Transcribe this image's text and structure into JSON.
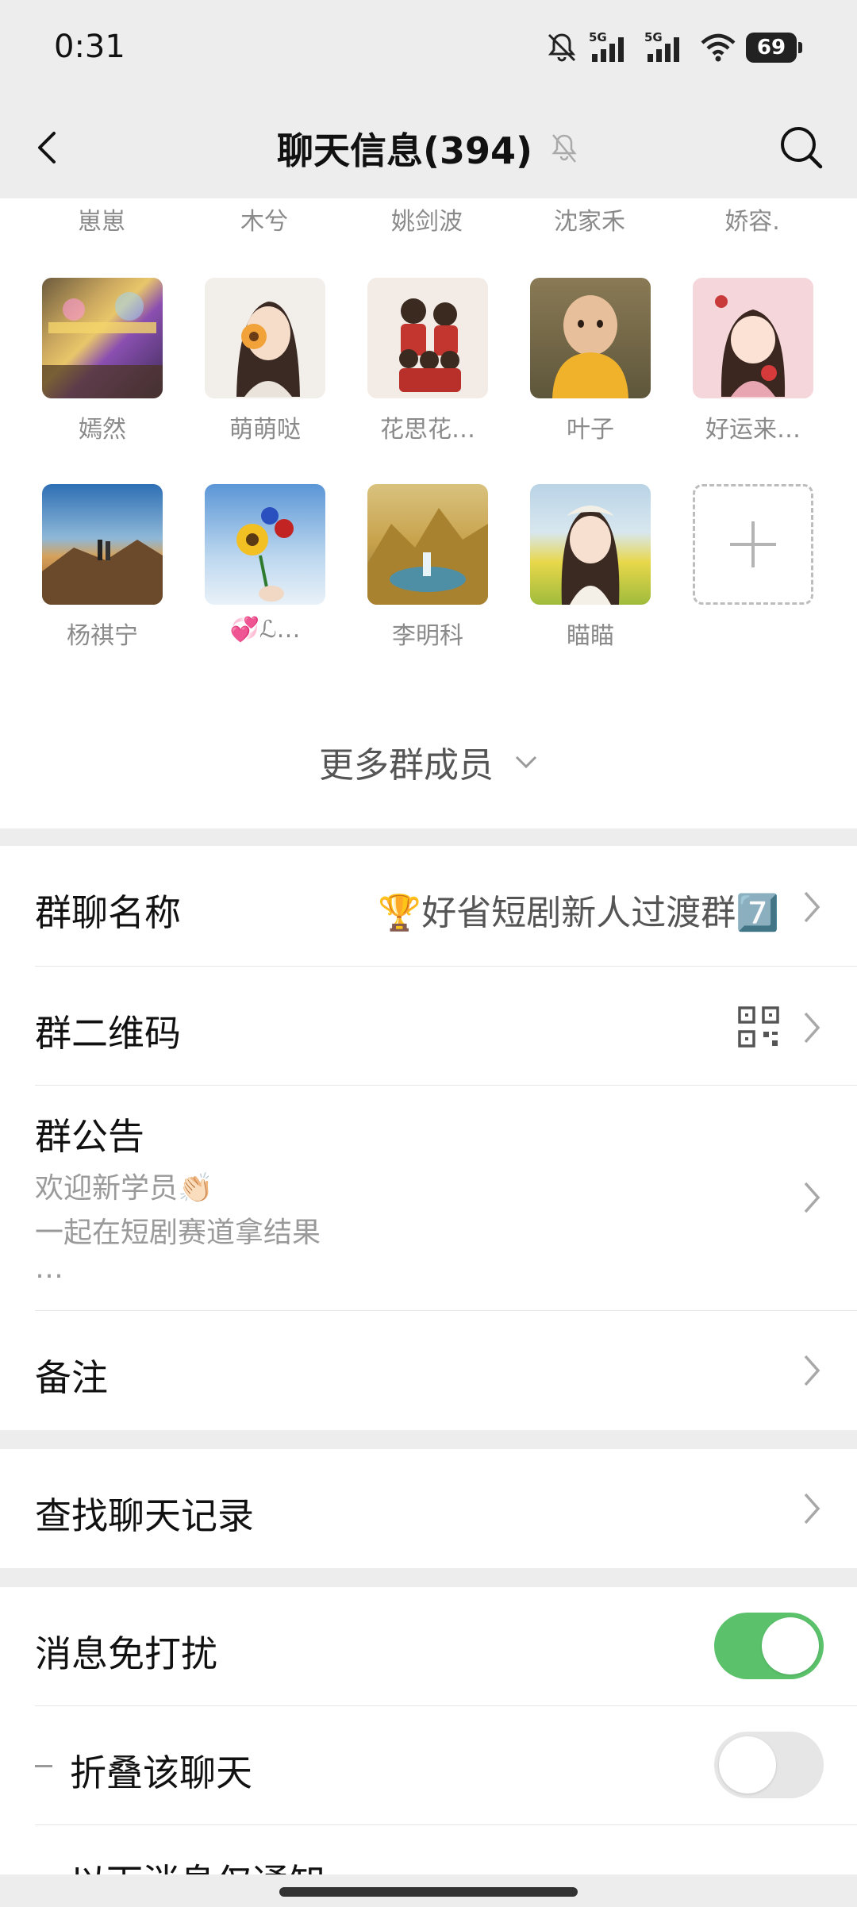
{
  "status_bar": {
    "time": "0:31",
    "battery": "69",
    "network_labels": [
      "5G",
      "5G"
    ],
    "icons": [
      "mute-bell-icon",
      "signal-5g-icon",
      "signal-5g-icon",
      "wifi-icon",
      "battery-icon"
    ]
  },
  "header": {
    "title": "聊天信息(394)",
    "icons": [
      "back-icon",
      "muted-bell-icon",
      "search-icon"
    ]
  },
  "members": {
    "partial_names": [
      "崽崽",
      "木兮",
      "姚剑波",
      "沈家禾",
      "娇容."
    ],
    "row1": [
      {
        "name": "嫣然"
      },
      {
        "name": "萌萌哒"
      },
      {
        "name": "花思花…"
      },
      {
        "name": "叶子"
      },
      {
        "name": "好运来…"
      }
    ],
    "row2": [
      {
        "name": "杨祺宁"
      },
      {
        "name": "💞ℒ…"
      },
      {
        "name": "李明科"
      },
      {
        "name": "瞄瞄"
      }
    ],
    "add_icon": "plus-icon",
    "more_label": "更多群成员"
  },
  "settings": {
    "group_name_label": "群聊名称",
    "group_name_value": "🏆好省短剧新人过渡群7️⃣",
    "qr_label": "群二维码",
    "announcement_label": "群公告",
    "announcement_lines": [
      "欢迎新学员👏🏻",
      "一起在短剧赛道拿结果",
      "…"
    ],
    "remark_label": "备注",
    "search_history_label": "查找聊天记录",
    "dnd_label": "消息免打扰",
    "dnd_enabled": true,
    "fold_label": "折叠该聊天",
    "fold_enabled": false,
    "notify_partial_label": "以下消息仅通知"
  },
  "colors": {
    "background": "#ededed",
    "toggle_on": "#5bc26b",
    "toggle_off": "#e6e6e6"
  }
}
